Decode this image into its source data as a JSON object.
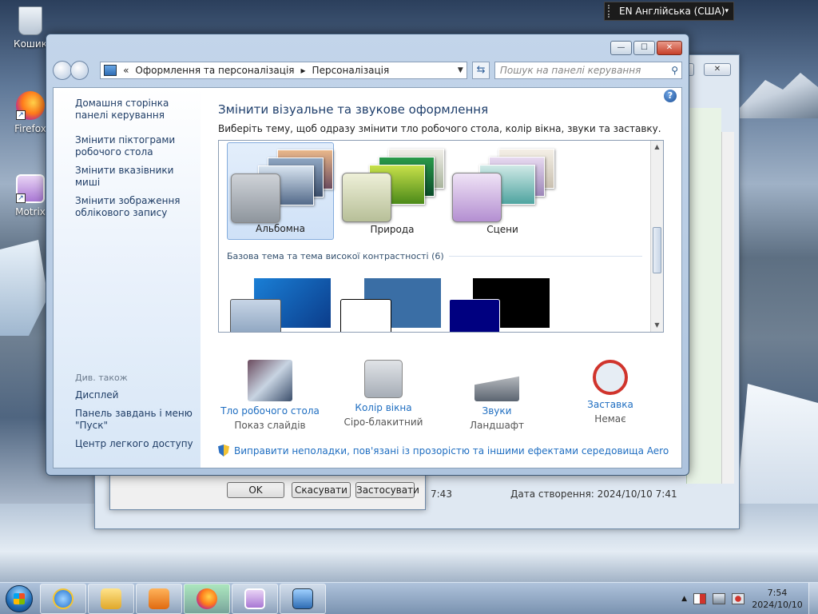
{
  "desktop": {
    "icons": [
      {
        "label": "Кошик",
        "icon": "recycle-bin-icon"
      },
      {
        "label": "Firefox",
        "icon": "firefox-icon"
      },
      {
        "label": "Motrix",
        "icon": "motrix-icon"
      }
    ]
  },
  "lang_bar": {
    "label": "EN Англійська (США)"
  },
  "background_window": {
    "buttons": [
      "OK",
      "Скасувати",
      "Застосувати"
    ],
    "modified_time_partial": "7:43",
    "created_label": "Дата створення: 2024/10/10 ",
    "created_time": "7:41",
    "status_partial": "7:43"
  },
  "window": {
    "controls": {
      "minimize": "—",
      "maximize": "☐",
      "close": "✕"
    },
    "breadcrumb": {
      "root": "Оформлення та персоналізація",
      "current": "Персоналізація",
      "lead": "«",
      "sep": "▸"
    },
    "search_placeholder": "Пошук на панелі керування",
    "left_links": [
      "Домашня сторінка панелі керування",
      "Змінити піктограми робочого стола",
      "Змінити вказівники миші",
      "Змінити зображення облікового запису"
    ],
    "see_also": {
      "header": "Див. також",
      "links": [
        "Дисплей",
        "Панель завдань і меню \"Пуск\"",
        "Центр легкого доступу"
      ]
    },
    "heading": "Змінити візуальне та звукове оформлення",
    "subheading": "Виберіть тему, щоб одразу змінити тло робочого стола, колір вікна, звуки та заставку.",
    "themes": [
      {
        "name": "Альбомна",
        "selected": true
      },
      {
        "name": "Природа",
        "selected": false
      },
      {
        "name": "Сцени",
        "selected": false
      }
    ],
    "basic_group_label": "Базова тема та тема високої контрастності (6)",
    "bottom_items": [
      {
        "name": "Тло робочого стола",
        "value": "Показ слайдів",
        "icon": "desktop-background-icon"
      },
      {
        "name": "Колір вікна",
        "value": "Сіро-блакитний",
        "icon": "window-color-icon"
      },
      {
        "name": "Звуки",
        "value": "Ландшафт",
        "icon": "sounds-icon"
      },
      {
        "name": "Заставка",
        "value": "Немає",
        "icon": "screensaver-icon"
      }
    ],
    "aero_link": "Виправити неполадки, пов'язані із прозорістю та іншими ефектами середовища Aero"
  },
  "taskbar": {
    "apps": [
      "internet-explorer-icon",
      "file-explorer-icon",
      "media-player-icon",
      "firefox-icon",
      "motrix-icon",
      "control-panel-icon"
    ],
    "clock_time": "7:54",
    "clock_date": "2024/10/10",
    "tray_arrow": "▲"
  },
  "colors": {
    "accent_link": "#1f6ec1",
    "heading": "#1e3e6b",
    "taskbar_active": "#8fd48f"
  }
}
